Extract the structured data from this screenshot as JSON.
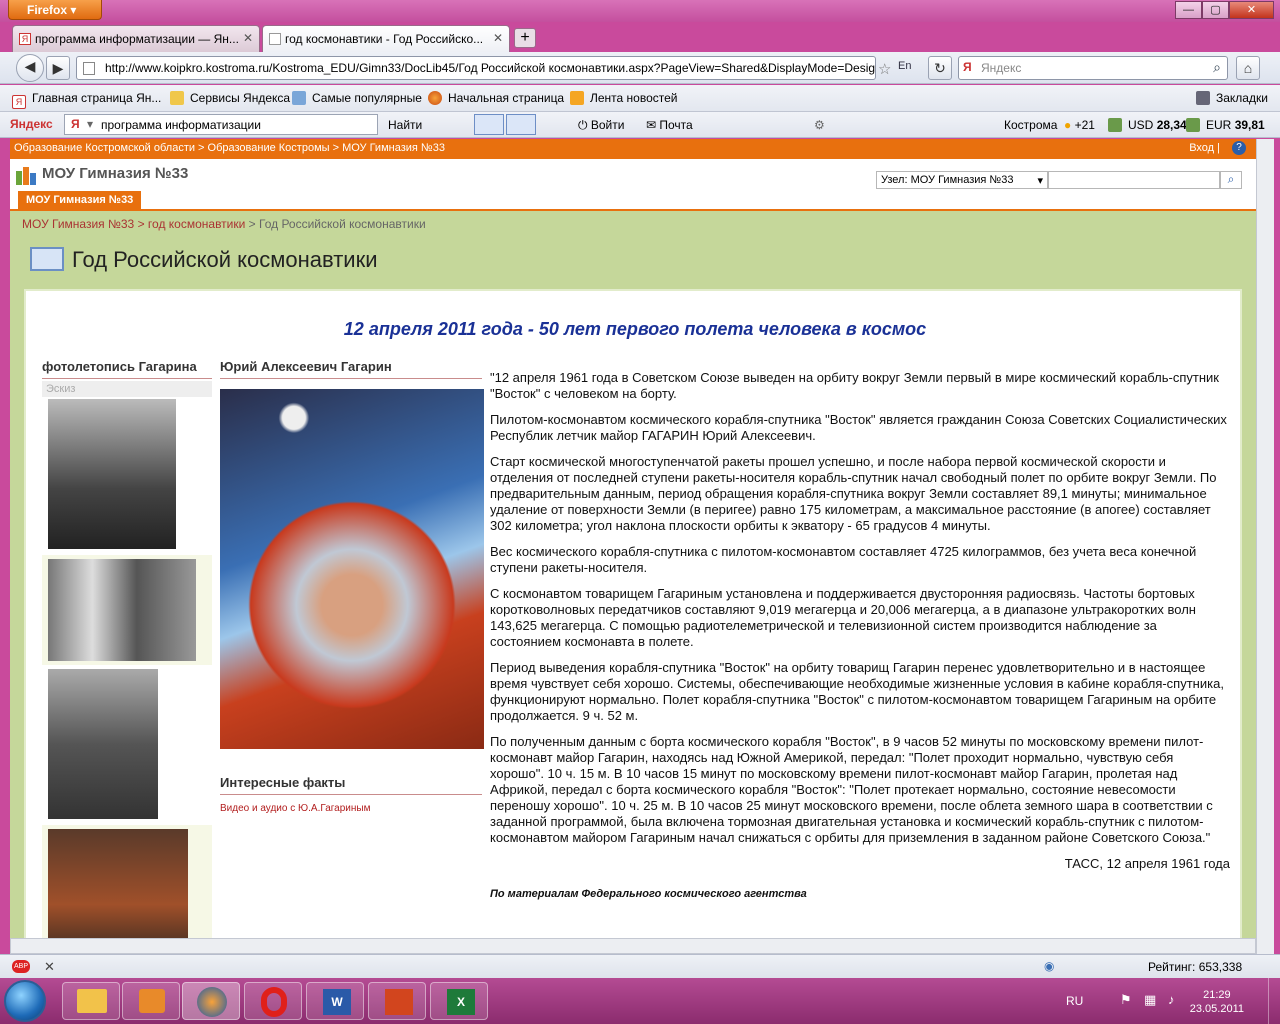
{
  "browser": {
    "app_button": "Firefox",
    "tabs": [
      {
        "label": "программа информатизации — Ян..."
      },
      {
        "label": "год космонавтики - Год Российско..."
      }
    ],
    "url": "http://www.koipkro.kostroma.ru/Kostroma_EDU/Gimn33/DocLib45/Год Российской космонавтики.aspx?PageView=Shared&DisplayMode=Design",
    "search_placeholder": "Яндекс",
    "bookmarks": [
      "Главная страница Ян...",
      "Сервисы Яндекса",
      "Самые популярные",
      "Начальная страница",
      "Лента новостей"
    ],
    "bookmarks_menu": "Закладки",
    "yandex_bar": {
      "logo": "Яндекс",
      "query": "программа информатизации",
      "find_button": "Найти",
      "login": "Войти",
      "mail": "Почта",
      "city": "Кострома",
      "temp": "+21",
      "usd_label": "USD",
      "usd": "28,34",
      "eur_label": "EUR",
      "eur": "39,81"
    }
  },
  "site": {
    "top_crumbs": "Образование Костромской области > Образование Костромы > МОУ Гимназия №33",
    "login_link": "Вход |",
    "site_name": "МОУ Гимназия №33",
    "top_nav_item": "МОУ Гимназия №33",
    "node_select": "Узел: МОУ Гимназия №33",
    "breadcrumb": {
      "first": "МОУ Гимназия №33",
      "sep1": " > ",
      "second": "год космонавтики",
      "sep2": " > ",
      "current": "Год Российской космонавтики"
    },
    "page_title": "Год Российской космонавтики"
  },
  "article": {
    "heading": "12 апреля 2011 года - 50 лет первого полета человека в космос",
    "left_title": "фотолетопись Гагарина",
    "sketch_label": "Эскиз",
    "mid_title": "Юрий Алексеевич Гагарин",
    "facts_title": "Интересные факты",
    "facts_link": "Видео и аудио с Ю.А.Гагариным",
    "paragraphs": [
      "\"12 апреля 1961 года в Советском Союзе выведен на орбиту вокруг Земли первый в мире космический корабль-спутник \"Восток\" с человеком на борту.",
      "Пилотом-космонавтом космического корабля-спутника \"Восток\" является гражданин Союза Советских Социалистических Республик летчик майор ГАГАРИН Юрий Алексеевич.",
      " Старт космической многоступенчатой ракеты прошел успешно, и после набора первой космической скорости и отделения от последней ступени ракеты-носителя корабль-спутник начал свободный полет по орбите вокруг Земли. По предварительным данным, период обращения корабля-спутника вокруг Земли составляет 89,1 минуты; минимальное удаление от поверхности Земли (в перигее) равно 175 километрам, а максимальное расстояние (в апогее) составляет 302 километра; угол наклона плоскости орбиты к экватору - 65 градусов 4 минуты.",
      " Вес космического корабля-спутника с пилотом-космонавтом составляет 4725 килограммов, без учета веса конечной ступени ракеты-носителя.",
      " С космонавтом товарищем Гагариным установлена и поддерживается двусторонняя радиосвязь. Частоты бортовых коротковолновых передатчиков составляют 9,019 мегагерца и 20,006 мегагерца, а в диапазоне ультракоротких волн 143,625 мегагерца. С помощью радиотелеметрической и телевизионной систем производится наблюдение за состоянием космонавта в полете.",
      "Период выведения корабля-спутника \"Восток\" на орбиту товарищ Гагарин перенес удовлетворительно и в настоящее время чувствует себя хорошо. Системы, обеспечивающие необходимые жизненные условия в кабине корабля-спутника, функционируют нормально. Полет корабля-спутника \"Восток\" с пилотом-космонавтом товарищем Гагариным на орбите продолжается. 9 ч. 52 м.",
      "По полученным данным с борта космического корабля \"Восток\", в 9 часов 52 минуты по московскому времени пилот-космонавт майор Гагарин, находясь над Южной Америкой, передал: \"Полет проходит нормально, чувствую себя хорошо\". 10 ч. 15 м. В 10 часов 15 минут по московскому времени пилот-космонавт майор Гагарин, пролетая над Африкой, передал с борта космического корабля \"Восток\": \"Полет протекает нормально, состояние невесомости переношу хорошо\". 10 ч. 25 м. В 10 часов 25 минут московского времени, после облета земного шара в соответствии с заданной программой, была включена тормозная двигательная установка и космический корабль-спутник с пилотом-космонавтом майором Гагариным начал снижаться с орбиты для приземления в заданном районе Советского Союза.\""
    ],
    "signature": "ТАСС, 12 апреля 1961 года",
    "source": "По материалам Федерального космического агентства"
  },
  "status": {
    "rating_label": "Рейтинг:",
    "rating": "653,338"
  },
  "taskbar": {
    "lang": "RU",
    "time": "21:29",
    "date": "23.05.2011"
  },
  "colors": {
    "accent": "#e8700e",
    "title_blue": "#1a3196",
    "link_red": "#b21e1e",
    "window_frame": "#c94a9c"
  }
}
